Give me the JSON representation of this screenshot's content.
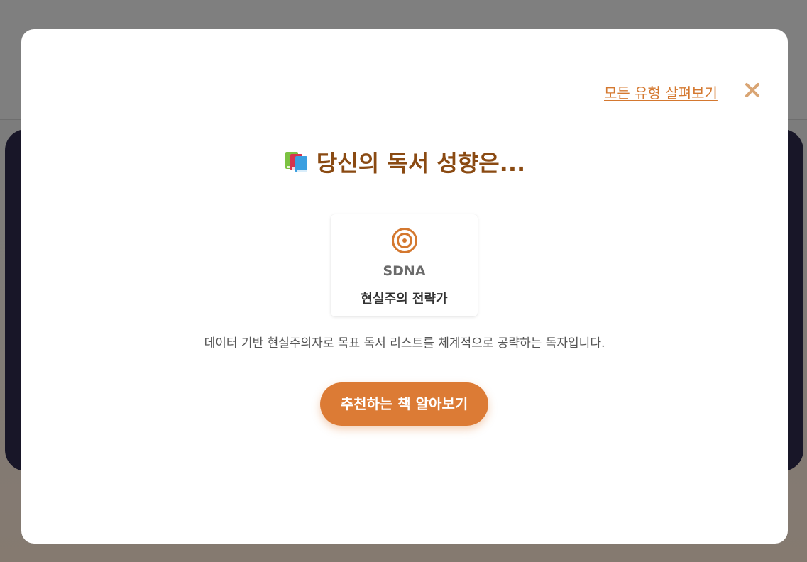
{
  "modal": {
    "browse_all_link": "모든 유형 살펴보기",
    "close_icon": "close-icon",
    "heading": {
      "icon": "books-icon",
      "text": "당신의 독서 성향은..."
    },
    "result_card": {
      "icon": "target-icon",
      "code": "SDNA",
      "name": "현실주의 전략가"
    },
    "description": "데이터 기반 현실주의자로 목표 독서 리스트를 체계적으로 공략하는 독자입니다.",
    "cta_button": "추천하는 책 알아보기"
  },
  "colors": {
    "accent": "#dc7b35",
    "link": "#d4782f",
    "heading": "#8a4a12",
    "overlay": "#808080",
    "background_card": "#181628"
  }
}
